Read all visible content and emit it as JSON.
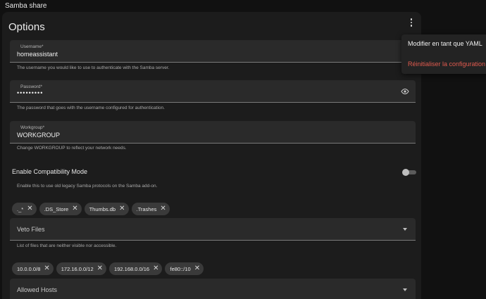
{
  "header": {
    "title": "Samba share"
  },
  "card": {
    "title": "Options"
  },
  "fields": {
    "username": {
      "label": "Username*",
      "value": "homeassistant",
      "helper": "The username you would like to use to authenticate with the Samba server."
    },
    "password": {
      "label": "Password*",
      "value": "•••••••••",
      "helper": "The password that goes with the username configured for authentication."
    },
    "workgroup": {
      "label": "Workgroup*",
      "value": "WORKGROUP",
      "helper": "Change WORKGROUP to reflect your network needs."
    }
  },
  "compatibility": {
    "label": "Enable Compatibility Mode",
    "helper": "Enable this to use old legacy Samba protocols on the Samba add-on.",
    "enabled": false
  },
  "veto": {
    "chips": [
      "._*",
      ".DS_Store",
      "Thumbs.db",
      ".Trashes"
    ],
    "label": "Veto Files",
    "helper": "List of files that are neither visible nor accessible."
  },
  "hosts": {
    "chips": [
      "10.0.0.0/8",
      "172.16.0.0/12",
      "192.168.0.0/16",
      "fe80::/10"
    ],
    "label": "Allowed Hosts"
  },
  "menu": {
    "items": [
      "Modifier en tant que YAML",
      "Réinitialiser la configuration"
    ]
  },
  "colors": {
    "danger": "#e05a4e",
    "background": "#111111",
    "card": "#1c1c1c"
  },
  "icons": {
    "password_toggle": "eye-icon",
    "menu": "more-vert-icon",
    "chip_remove": "close-icon",
    "dropdown": "caret-down-icon"
  }
}
